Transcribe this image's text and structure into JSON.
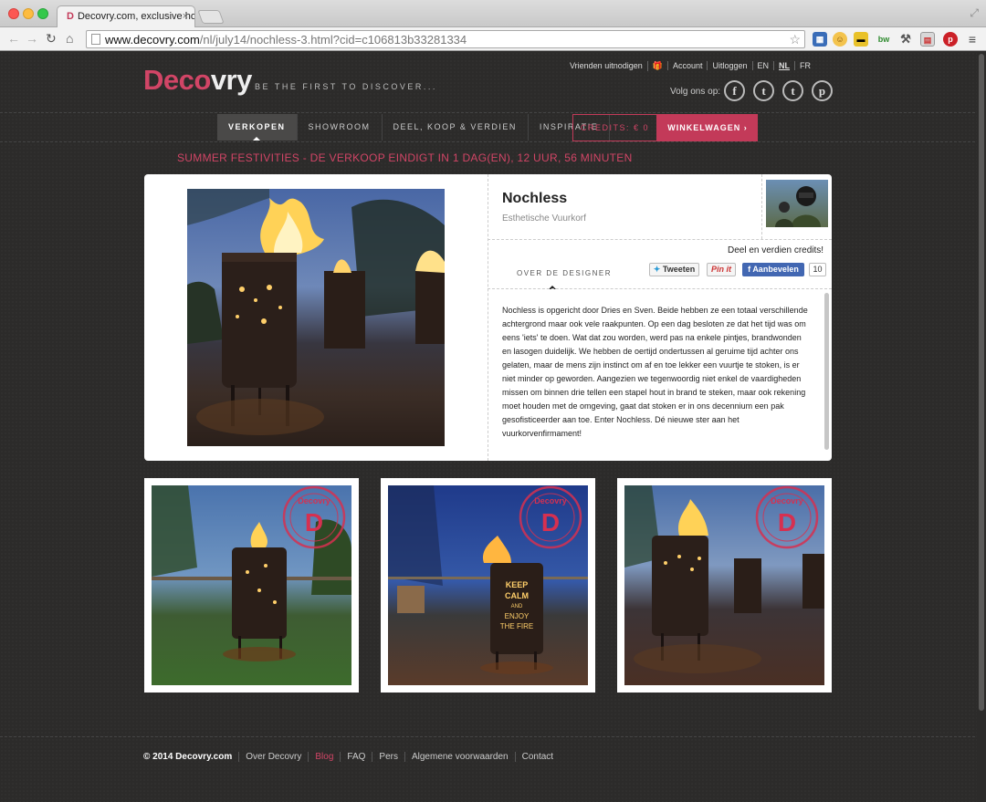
{
  "browser": {
    "tab_title": "Decovry.com, exclusive ho",
    "tab_favicon": "D",
    "tab_close": "×",
    "url_host": "www.decovry.com",
    "url_path": "/nl/july14/nochless-3.html?cid=c106813b33281334"
  },
  "header": {
    "logo_part1": "Deco",
    "logo_part2": "vry",
    "tagline": "BE THE FIRST TO DISCOVER...",
    "top_links": [
      "Vrienden uitnodigen",
      "🎁",
      "Account",
      "Uitloggen",
      "EN",
      "NL",
      "FR"
    ],
    "follow_label": "Volg ons op:",
    "social": {
      "facebook": "f",
      "twitter": "t",
      "tumblr": "t",
      "pinterest": "p"
    }
  },
  "nav": {
    "items": [
      "VERKOPEN",
      "SHOWROOM",
      "DEEL, KOOP & VERDIEN",
      "INSPIRATIE"
    ],
    "credits": "CREDITS: € 0",
    "cart": "WINKELWAGEN ›"
  },
  "promo": "SUMMER FESTIVITIES - DE VERKOOP EINDIGT IN 1 DAG(EN), 12 UUR, 56 MINUTEN",
  "product": {
    "title": "Nochless",
    "subtitle": "Esthetische Vuurkorf",
    "share_credits": "Deel en verdien credits!",
    "designer_tab": "OVER DE DESIGNER",
    "tweet": "Tweeten",
    "pin": "Pin it",
    "like": "Aanbevelen",
    "like_count": "10",
    "description": "Nochless is opgericht door Dries en Sven. Beide hebben ze een totaal verschillende achtergrond maar ook vele raakpunten. Op een dag besloten ze dat het tijd was om eens 'iets' te doen. Wat dat zou worden, werd pas na enkele pintjes, brandwonden en lasogen duidelijk. We hebben de oertijd ondertussen al geruime tijd achter ons gelaten, maar de mens zijn instinct om af en toe lekker een vuurtje te stoken, is er niet minder op geworden. Aangezien we tegenwoordig niet enkel de vaardigheden missen om binnen drie tellen een stapel hout in brand te steken, maar ook rekening moet houden met de omgeving, gaat dat stoken er in ons decennium een pak gesofisticeerder aan toe. Enter Nochless. Dé nieuwe ster aan het vuurkorvenfirmament!"
  },
  "thumbnails": {
    "stamp_text": "Decovry",
    "stamp_letter": "D",
    "keep_calm": [
      "KEEP",
      "CALM",
      "AND",
      "ENJOY",
      "THE FIRE"
    ]
  },
  "footer": {
    "links": [
      "© 2014 Decovry.com",
      "Over Decovry",
      "Blog",
      "FAQ",
      "Pers",
      "Algemene voorwaarden",
      "Contact"
    ]
  },
  "colors": {
    "accent": "#c33a59",
    "accent_text": "#d14566",
    "background": "#2b2a29"
  }
}
